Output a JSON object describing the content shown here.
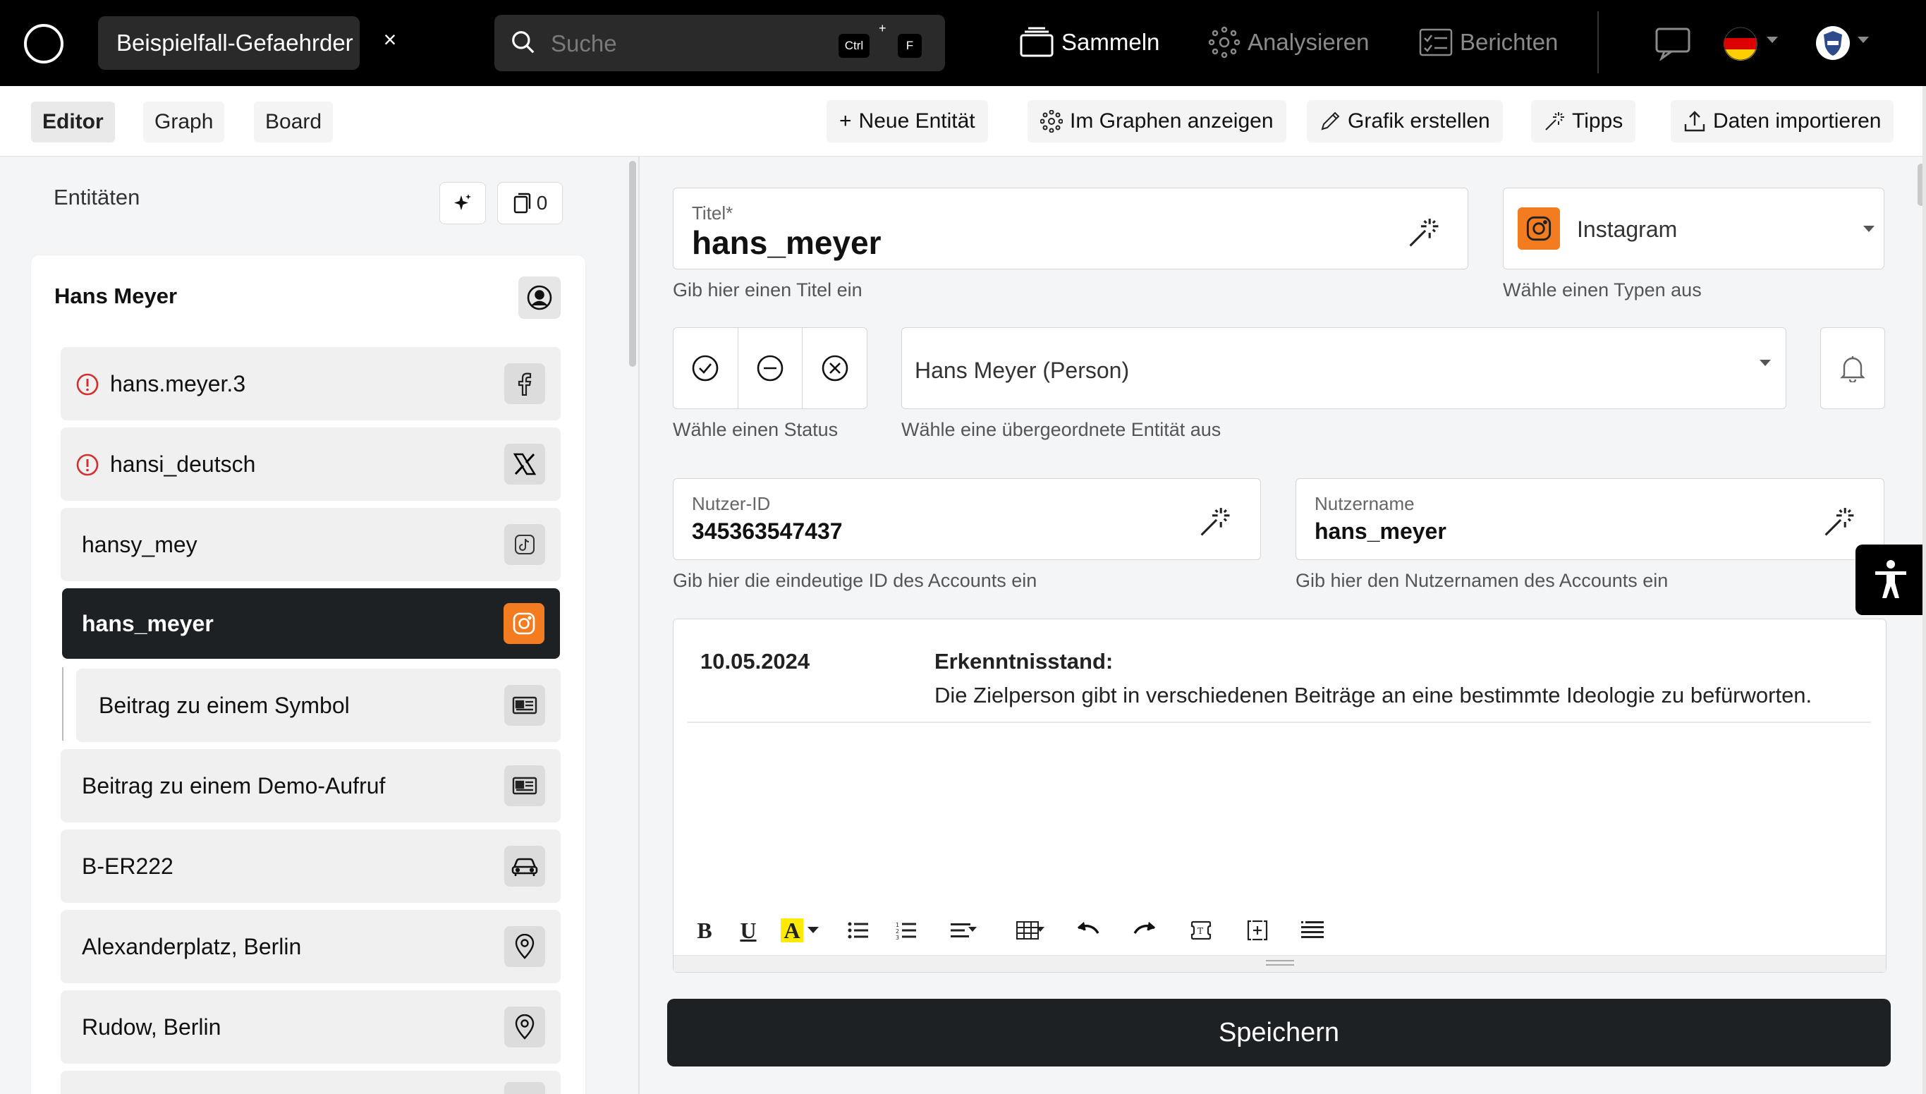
{
  "topbar": {
    "case_tab": "Beispielfall-Gefaehrder",
    "close_glyph": "×",
    "search": {
      "placeholder": "Suche",
      "shortcut_key1": "Ctrl",
      "shortcut_plus": "+",
      "shortcut_key2": "F"
    },
    "nav": {
      "collect": "Sammeln",
      "analyze": "Analysieren",
      "report": "Berichten"
    },
    "icons": [
      "logo-circle-icon",
      "search-icon",
      "collect-icon",
      "analyze-icon",
      "report-icon",
      "chat-icon",
      "german-flag-icon",
      "chevron-down-icon",
      "police-badge-icon"
    ]
  },
  "toolbar": {
    "tabs": {
      "editor": "Editor",
      "graph": "Graph",
      "board": "Board"
    },
    "buttons": {
      "new_entity": "Neue Entität",
      "show_graph": "Im Graphen anzeigen",
      "create_graphic": "Grafik erstellen",
      "tips": "Tipps",
      "import": "Daten importieren"
    },
    "new_entity_glyph": "+"
  },
  "entities": {
    "title": "Entitäten",
    "count": "0",
    "card_title": "Hans Meyer",
    "items": [
      {
        "label": "hans.meyer.3",
        "icon": "facebook-icon",
        "warning": true
      },
      {
        "label": "hansi_deutsch",
        "icon": "x-icon",
        "warning": true
      },
      {
        "label": "hansy_mey",
        "icon": "tiktok-icon",
        "warning": false
      },
      {
        "label": "hans_meyer",
        "icon": "instagram-icon",
        "warning": false,
        "selected": true
      },
      {
        "label": "Beitrag zu einem Symbol",
        "icon": "post-icon",
        "warning": false,
        "child": true
      },
      {
        "label": "Beitrag zu einem Demo-Aufruf",
        "icon": "post-icon",
        "warning": false
      },
      {
        "label": "B-ER222",
        "icon": "car-icon",
        "warning": false
      },
      {
        "label": "Alexanderplatz, Berlin",
        "icon": "location-pin-icon",
        "warning": false
      },
      {
        "label": "Rudow, Berlin",
        "icon": "location-pin-icon",
        "warning": false
      }
    ]
  },
  "form": {
    "title_label": "Titel*",
    "title_value": "hans_meyer",
    "title_help": "Gib hier einen Titel ein",
    "type_value": "Instagram",
    "type_help": "Wähle einen Typen aus",
    "status_help": "Wähle einen Status",
    "parent_value": "Hans Meyer (Person)",
    "parent_help": "Wähle eine übergeordnete Entität aus",
    "userid_label": "Nutzer-ID",
    "userid_value": "345363547437",
    "userid_help": "Gib hier die eindeutige ID des Accounts ein",
    "username_label": "Nutzername",
    "username_value": "hans_meyer",
    "username_help": "Gib hier den Nutzernamen des Accounts ein"
  },
  "editor": {
    "date": "10.05.2024",
    "heading": "Erkenntnisstand:",
    "text": "Die Zielperson gibt in verschiedenen Beiträge an eine bestimmte Ideologie zu befürworten.",
    "bold": "B",
    "underline": "U",
    "highlight": "A"
  },
  "save_label": "Speichern",
  "colors": {
    "instagram": "#f47c20",
    "dark": "#1e2124",
    "warning": "#d32f2f",
    "highlight": "#ffea00"
  }
}
